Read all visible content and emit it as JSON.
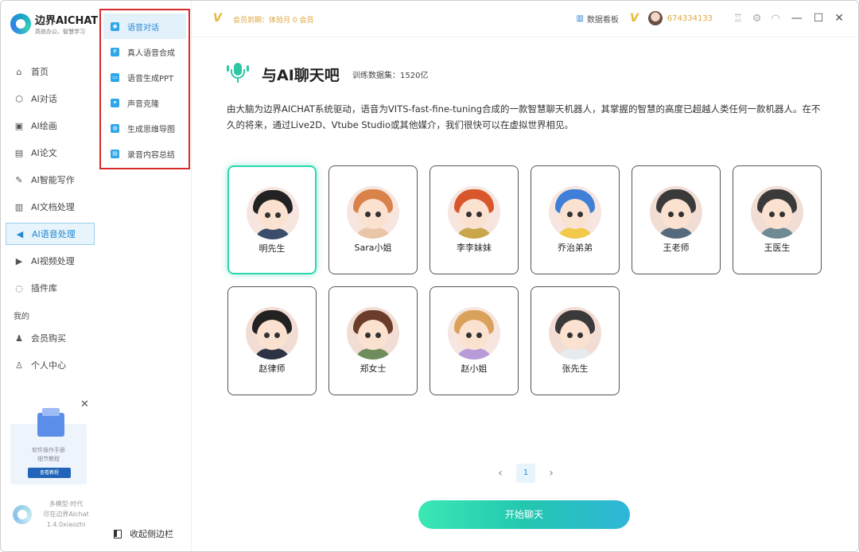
{
  "brand": {
    "name": "边界AICHAT",
    "tagline": "高效办公、智慧学习"
  },
  "sidebar": {
    "items": [
      {
        "label": "首页",
        "icon": "home-icon",
        "glyph": "⌂"
      },
      {
        "label": "AI对话",
        "icon": "cube-icon",
        "glyph": "⬡"
      },
      {
        "label": "AI绘画",
        "icon": "image-icon",
        "glyph": "▣"
      },
      {
        "label": "AI论文",
        "icon": "document-icon",
        "glyph": "▤"
      },
      {
        "label": "AI智能写作",
        "icon": "pen-icon",
        "glyph": "✎"
      },
      {
        "label": "AI文档处理",
        "icon": "file-icon",
        "glyph": "▥"
      },
      {
        "label": "AI语音处理",
        "icon": "speaker-icon",
        "glyph": "◀"
      },
      {
        "label": "AI视频处理",
        "icon": "video-icon",
        "glyph": "▶"
      },
      {
        "label": "插件库",
        "icon": "bulb-icon",
        "glyph": "◌"
      }
    ],
    "section_mine": "我的",
    "mine_items": [
      {
        "label": "会员购买",
        "icon": "user-icon",
        "glyph": "♟"
      },
      {
        "label": "个人中心",
        "icon": "profile-icon",
        "glyph": "♙"
      }
    ],
    "promo": {
      "line1": "软件操作手册",
      "line2": "细节教程",
      "button": "查看教程",
      "close": "✕"
    },
    "footer": {
      "line1": "多模型·时代",
      "line2": "尽在边界AIchat",
      "version": "1.4.0xiaozhi"
    }
  },
  "submenu": {
    "items": [
      {
        "label": "语音对话",
        "icon": "mic-icon",
        "glyph": "◉"
      },
      {
        "label": "真人语音合成",
        "icon": "p-badge-icon",
        "glyph": "P"
      },
      {
        "label": "语音生成PPT",
        "icon": "ppt-icon",
        "glyph": "▭"
      },
      {
        "label": "声音克隆",
        "icon": "clone-icon",
        "glyph": "✦"
      },
      {
        "label": "生成思维导图",
        "icon": "mindmap-icon",
        "glyph": "◍"
      },
      {
        "label": "录音内容总结",
        "icon": "recorder-icon",
        "glyph": "▤"
      }
    ],
    "collapse_label": "收起侧边栏"
  },
  "topbar": {
    "vip_logo": "V",
    "vip_text": "会员到期：体验月 0 会员",
    "dashboard": "数据看板",
    "user_id": "674334133",
    "window_controls": {
      "minimize": "—",
      "maximize": "☐",
      "close": "✕"
    },
    "tool_icons": [
      "shirt-icon",
      "gear-icon",
      "headset-icon"
    ],
    "tool_glyphs": [
      "♖",
      "⚙",
      "◠"
    ]
  },
  "main": {
    "title": "与AI聊天吧",
    "data_stat": "训练数据集：1520亿",
    "description": "由大脑为边界AICHAT系统驱动，语音为VITS-fast-fine-tuning合成的一款智慧聊天机器人，其掌握的智慧的高度已超越人类任何一款机器人。在不久的将来，通过Live2D、Vtube Studio或其他媒介，我们很快可以在虚拟世界相见。",
    "characters": [
      {
        "name": "明先生",
        "hair": "#222222",
        "shirt": "#3b4d6b",
        "bg": "#f6e6df"
      },
      {
        "name": "Sara小姐",
        "hair": "#d9824a",
        "shirt": "#e9c6a8",
        "bg": "#f6e6df"
      },
      {
        "name": "李李妹妹",
        "hair": "#d8562c",
        "shirt": "#c9a64a",
        "bg": "#f6e6df"
      },
      {
        "name": "乔治弟弟",
        "hair": "#3f7fd8",
        "shirt": "#f1c94b",
        "bg": "#f6e6df"
      },
      {
        "name": "王老师",
        "hair": "#3a3a3a",
        "shirt": "#556b7d",
        "bg": "#f2ddd5"
      },
      {
        "name": "王医生",
        "hair": "#3a3a3a",
        "shirt": "#6f8a93",
        "bg": "#f2ddd5"
      },
      {
        "name": "赵律师",
        "hair": "#222222",
        "shirt": "#2d3244",
        "bg": "#f2ddd5"
      },
      {
        "name": "郑女士",
        "hair": "#6b3c2a",
        "shirt": "#6f8d5c",
        "bg": "#f2ddd5"
      },
      {
        "name": "赵小姐",
        "hair": "#d9a15a",
        "shirt": "#b79ad8",
        "bg": "#f6e6df"
      },
      {
        "name": "张先生",
        "hair": "#3a3a3a",
        "shirt": "#e6ebf0",
        "bg": "#f2ddd5"
      }
    ],
    "pager": {
      "prev": "‹",
      "page": "1",
      "next": "›"
    },
    "start_button": "开始聊天"
  }
}
